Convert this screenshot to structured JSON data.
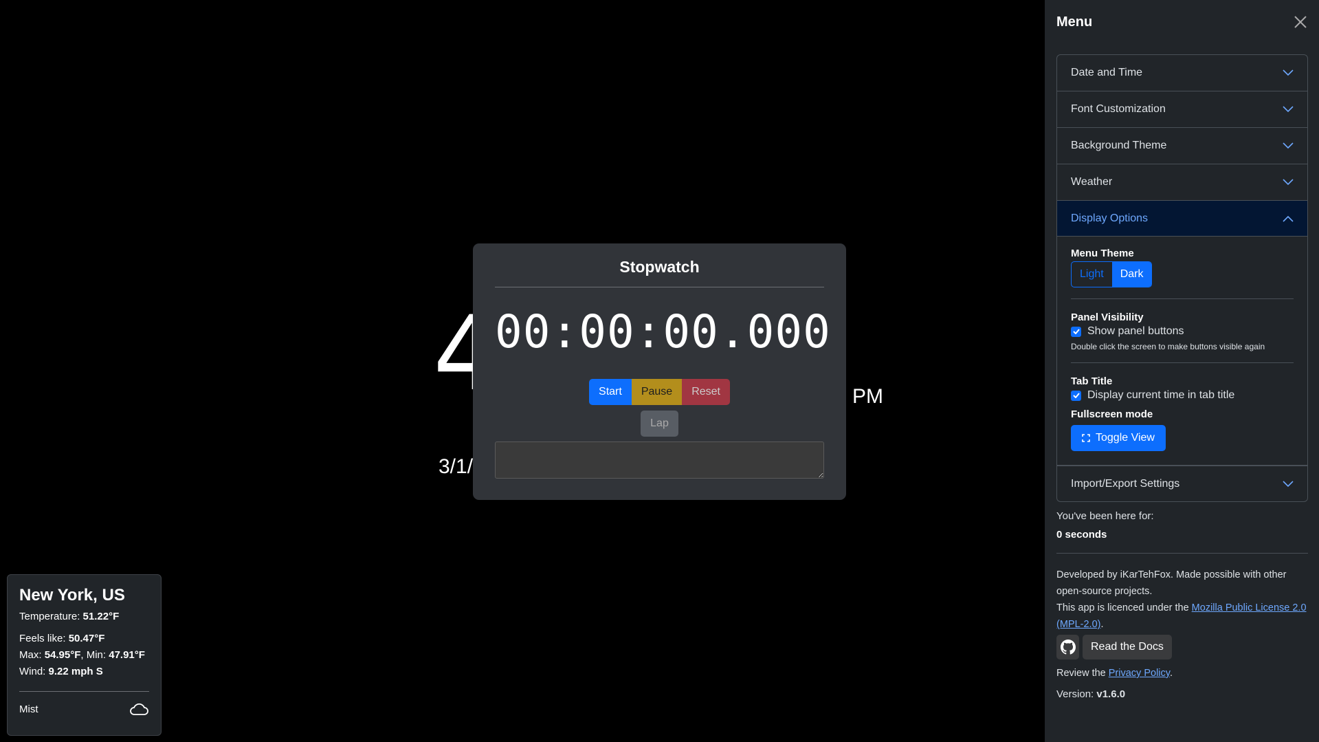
{
  "clock": {
    "time_partial": "4",
    "ampm": "PM",
    "date_partial": "3/1/"
  },
  "stopwatch": {
    "title": "Stopwatch",
    "time": "00:00:00.000",
    "start": "Start",
    "pause": "Pause",
    "reset": "Reset",
    "lap": "Lap",
    "laps_value": ""
  },
  "weather": {
    "city": "New York, US",
    "temp_label": "Temperature: ",
    "temp": "51.22°F",
    "feels_label": "Feels like: ",
    "feels": "50.47°F",
    "max_label": "Max: ",
    "max": "54.95°F",
    "min_label": ", Min: ",
    "min": "47.91°F",
    "wind_label": "Wind: ",
    "wind": "9.22 mph S",
    "condition": "Mist",
    "icon": "cloud-icon"
  },
  "menu": {
    "title": "Menu",
    "sections": [
      {
        "label": "Date and Time"
      },
      {
        "label": "Font Customization"
      },
      {
        "label": "Background Theme"
      },
      {
        "label": "Weather"
      },
      {
        "label": "Display Options"
      },
      {
        "label": "Import/Export Settings"
      }
    ],
    "display": {
      "theme_label": "Menu Theme",
      "light": "Light",
      "dark": "Dark",
      "panel_label": "Panel Visibility",
      "show_panel": "Show panel buttons",
      "panel_hint": "Double click the screen to make buttons visible again",
      "tab_label": "Tab Title",
      "tab_time": "Display current time in tab title",
      "fullscreen_label": "Fullscreen mode",
      "toggle": "Toggle View"
    },
    "here_label": "You've been here for:",
    "here_value": "0 seconds",
    "dev_text": "Developed by iKarTehFox. Made possible with other open-source projects.",
    "license_prefix": "This app is licenced under the ",
    "license_link": "Mozilla Public License 2.0 (MPL-2.0)",
    "license_suffix": ".",
    "docs": "Read the Docs",
    "privacy_prefix": "Review the ",
    "privacy_link": "Privacy Policy",
    "privacy_suffix": ".",
    "version_label": "Version: ",
    "version": "v1.6.0"
  }
}
